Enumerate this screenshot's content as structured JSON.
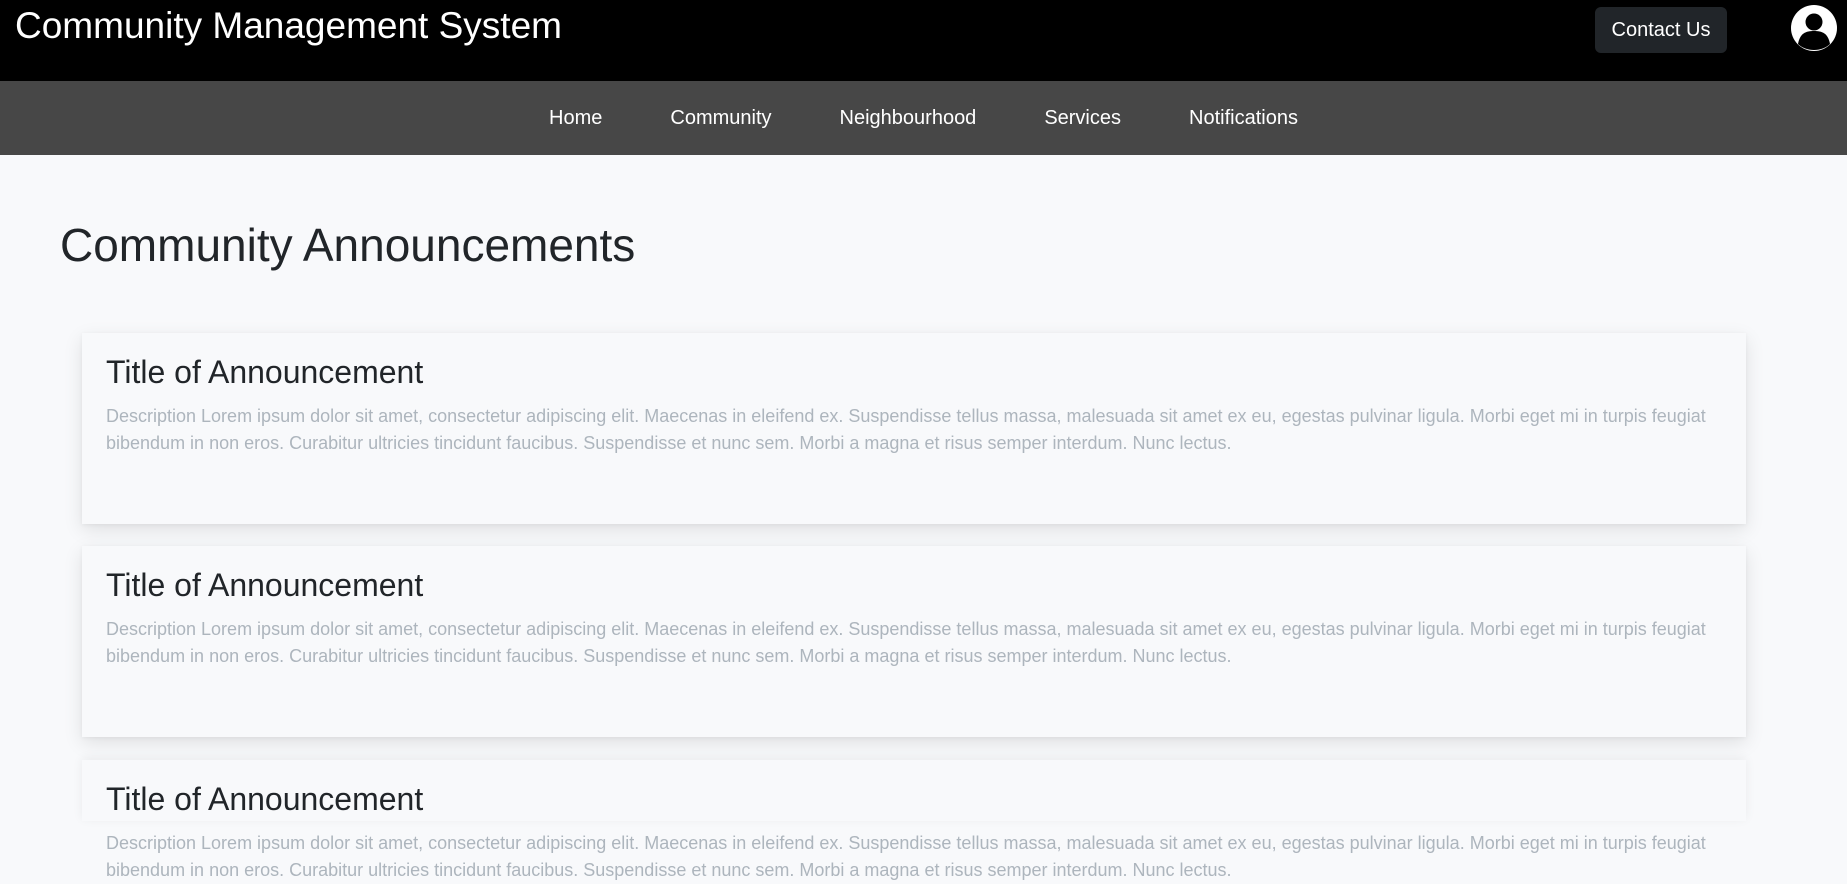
{
  "header": {
    "site_title": "Community Management System",
    "contact_label": "Contact Us",
    "avatar_icon": "user-circle-icon"
  },
  "nav": {
    "items": [
      {
        "label": "Home"
      },
      {
        "label": "Community"
      },
      {
        "label": "Neighbourhood"
      },
      {
        "label": "Services"
      },
      {
        "label": "Notifications"
      }
    ]
  },
  "main": {
    "heading": "Community Announcements",
    "announcements": [
      {
        "title": "Title of Announcement",
        "description": "Description Lorem ipsum dolor sit amet, consectetur adipiscing elit. Maecenas in eleifend ex. Suspendisse tellus massa, malesuada sit amet ex eu, egestas pulvinar ligula. Morbi eget mi in turpis feugiat bibendum in non eros. Curabitur ultricies tincidunt faucibus. Suspendisse et nunc sem. Morbi a magna et risus semper interdum. Nunc lectus."
      },
      {
        "title": "Title of Announcement",
        "description": "Description Lorem ipsum dolor sit amet, consectetur adipiscing elit. Maecenas in eleifend ex. Suspendisse tellus massa, malesuada sit amet ex eu, egestas pulvinar ligula. Morbi eget mi in turpis feugiat bibendum in non eros. Curabitur ultricies tincidunt faucibus. Suspendisse et nunc sem. Morbi a magna et risus semper interdum. Nunc lectus."
      },
      {
        "title": "Title of Announcement",
        "description": "Description Lorem ipsum dolor sit amet, consectetur adipiscing elit. Maecenas in eleifend ex. Suspendisse tellus massa, malesuada sit amet ex eu, egestas pulvinar ligula. Morbi eget mi in turpis feugiat bibendum in non eros. Curabitur ultricies tincidunt faucibus. Suspendisse et nunc sem. Morbi a magna et risus semper interdum. Nunc lectus."
      }
    ]
  },
  "colors": {
    "topbar_bg": "#000000",
    "navbar_bg": "#474747",
    "page_bg": "#f8f9fb",
    "button_bg": "#212529",
    "description_text": "#adb5bd"
  }
}
